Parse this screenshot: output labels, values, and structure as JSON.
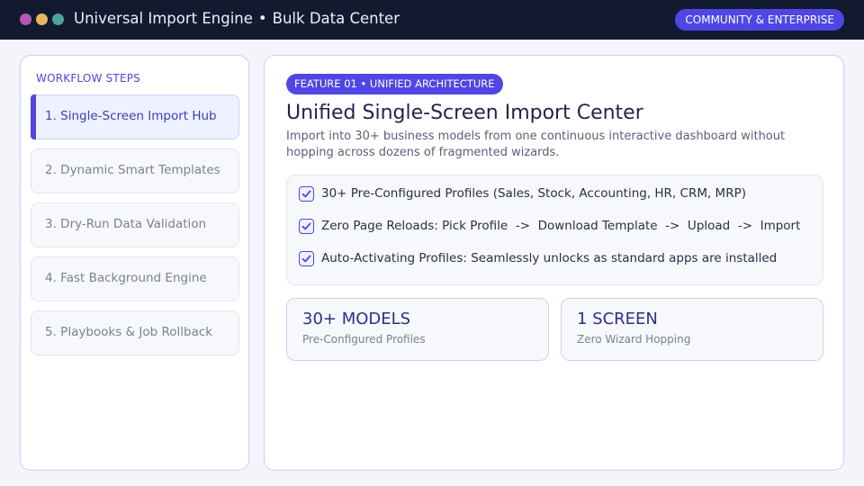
{
  "window": {
    "title": "Universal Import Engine",
    "separator": "•",
    "subtitle": "Bulk Data Center",
    "edition_badge": "COMMUNITY & ENTERPRISE",
    "traffic_light_colors": [
      "#b557b7",
      "#e8b85e",
      "#4fa39a"
    ]
  },
  "sidebar": {
    "heading": "WORKFLOW STEPS",
    "active_index": 0,
    "steps": [
      {
        "label": "1. Single-Screen Import Hub"
      },
      {
        "label": "2. Dynamic Smart Templates"
      },
      {
        "label": "3. Dry-Run Data Validation"
      },
      {
        "label": "4. Fast Background Engine"
      },
      {
        "label": "5. Playbooks & Job Rollback"
      }
    ]
  },
  "main": {
    "badge": "FEATURE 01 • UNIFIED ARCHITECTURE",
    "title": "Unified Single-Screen Import Center",
    "description": "Import into 30+ business models from one continuous interactive dashboard without hopping across dozens of fragmented wizards.",
    "checklist": [
      {
        "label": "30+ Pre-Configured Profiles (Sales, Stock, Accounting, HR, CRM, MRP)",
        "checked": true
      },
      {
        "label": "Zero Page Reloads: Pick Profile  ->  Download Template  ->  Upload  ->  Import",
        "checked": true
      },
      {
        "label": "Auto-Activating Profiles: Seamlessly unlocks as standard apps are installed",
        "checked": true
      }
    ],
    "stats": [
      {
        "value": "30+ MODELS",
        "label": "Pre-Configured Profiles"
      },
      {
        "value": "1 SCREEN",
        "label": "Zero Wizard Hopping"
      }
    ]
  },
  "colors": {
    "accent": "#4f46e5",
    "titlebar": "#121a30",
    "background": "#f3f5fb"
  }
}
